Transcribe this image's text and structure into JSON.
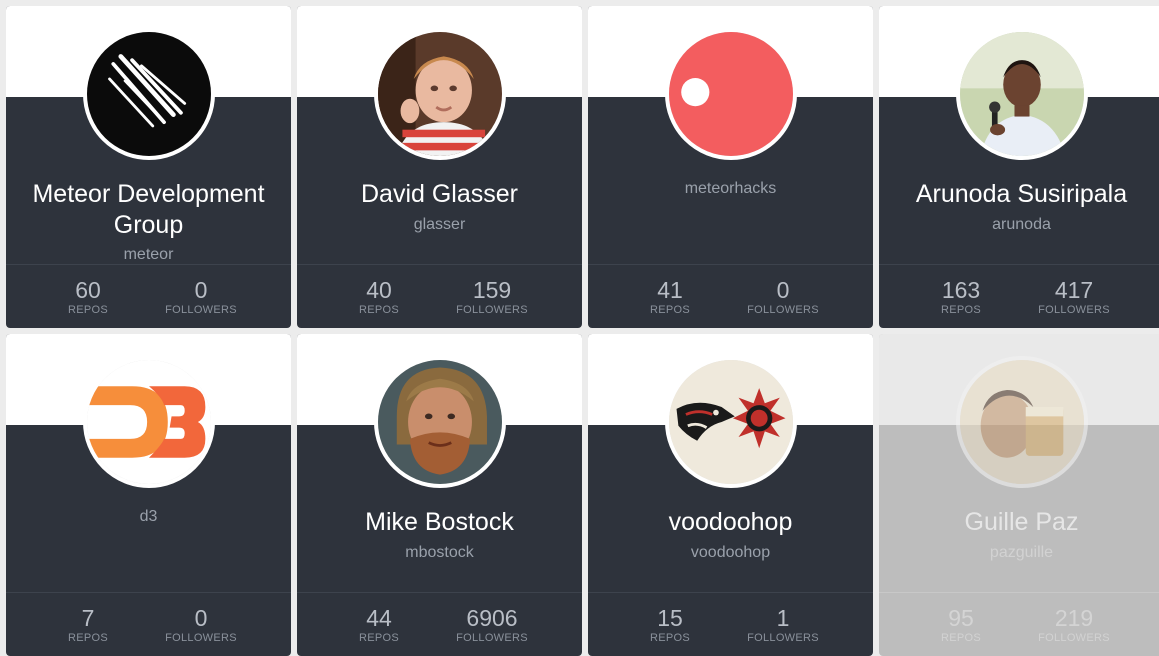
{
  "cards": [
    {
      "name": "Meteor Development Group",
      "login": "meteor",
      "repos": "60",
      "followers": "0",
      "avatar": "meteor-logo"
    },
    {
      "name": "David Glasser",
      "login": "glasser",
      "repos": "40",
      "followers": "159",
      "avatar": "photo-child"
    },
    {
      "name": "",
      "login": "meteorhacks",
      "repos": "41",
      "followers": "0",
      "avatar": "red-circle-logo"
    },
    {
      "name": "Arunoda Susiripala",
      "login": "arunoda",
      "repos": "163",
      "followers": "417",
      "avatar": "photo-speaker"
    },
    {
      "name": "",
      "login": "d3",
      "repos": "7",
      "followers": "0",
      "avatar": "d3-logo"
    },
    {
      "name": "Mike Bostock",
      "login": "mbostock",
      "repos": "44",
      "followers": "6906",
      "avatar": "photo-bearded-man"
    },
    {
      "name": "voodoohop",
      "login": "voodoohop",
      "repos": "15",
      "followers": "1",
      "avatar": "tribal-art"
    },
    {
      "name": "Guille Paz",
      "login": "pazguille",
      "repos": "95",
      "followers": "219",
      "avatar": "photo-drinking"
    }
  ],
  "labels": {
    "repos": "REPOS",
    "followers": "FOLLOWERS"
  }
}
